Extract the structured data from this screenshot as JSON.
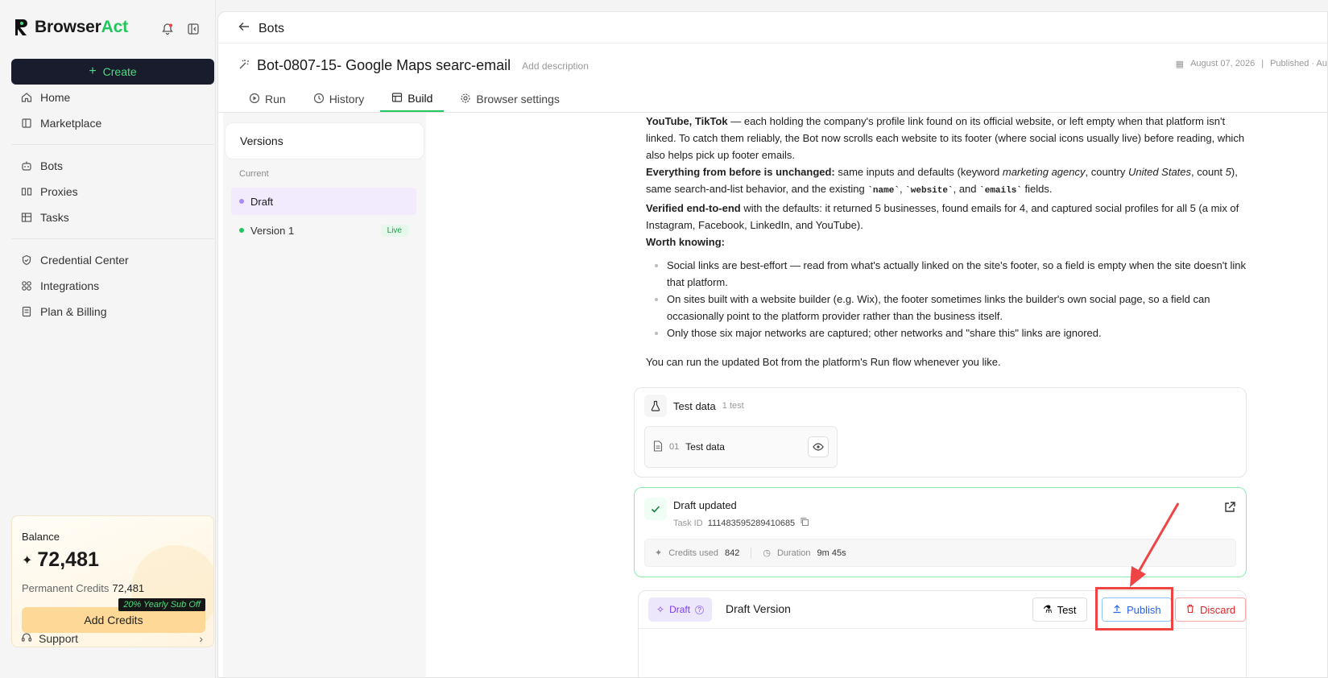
{
  "sidebar": {
    "brand_primary": "Browser",
    "brand_accent": "Act",
    "create_label": "Create",
    "items_group1": [
      {
        "label": "Home",
        "icon": "home-icon"
      },
      {
        "label": "Marketplace",
        "icon": "store-icon"
      }
    ],
    "items_group2": [
      {
        "label": "Bots",
        "icon": "bot-icon"
      },
      {
        "label": "Proxies",
        "icon": "proxy-icon"
      },
      {
        "label": "Tasks",
        "icon": "tasks-icon"
      }
    ],
    "items_group3": [
      {
        "label": "Credential Center",
        "icon": "shield-icon"
      },
      {
        "label": "Integrations",
        "icon": "integrations-icon"
      },
      {
        "label": "Plan & Billing",
        "icon": "billing-icon"
      }
    ],
    "balance": {
      "label": "Balance",
      "value": "72,481",
      "permanent_label": "Permanent Credits",
      "permanent_value": "72,481",
      "promo": "20% Yearly Sub Off",
      "add_label": "Add Credits"
    },
    "support_label": "Support"
  },
  "header": {
    "breadcrumb": "Bots",
    "bot_title": "Bot-0807-15- Google Maps searc-email",
    "add_description": "Add description",
    "date": "August 07, 2026",
    "status": "Published · Au"
  },
  "tabs": [
    {
      "label": "Run",
      "icon": "play-icon"
    },
    {
      "label": "History",
      "icon": "clock-icon"
    },
    {
      "label": "Build",
      "icon": "build-icon"
    },
    {
      "label": "Browser settings",
      "icon": "gear-icon"
    }
  ],
  "versions": {
    "header": "Versions",
    "current_label": "Current",
    "draft": "Draft",
    "version1": "Version 1",
    "live_badge": "Live"
  },
  "message": {
    "p1_bold": "YouTube, TikTok",
    "p1_rest": " — each holding the company's profile link found on its official website, or left empty when that platform isn't linked. To catch them reliably, the Bot now scrolls each website to its footer (where social icons usually live) before reading, which also helps pick up footer emails.",
    "p2_bold": "Everything from before is unchanged:",
    "p2_a": " same inputs and defaults (keyword ",
    "p2_kw": "marketing agency",
    "p2_b": ", country ",
    "p2_country": "United States",
    "p2_c": ", count ",
    "p2_count": "5",
    "p2_d": "), same search-and-list behavior, and the existing ",
    "code_name": "`name`",
    "sep1": ", ",
    "code_website": "`website`",
    "sep2": ", and ",
    "code_emails": "`emails`",
    "p2_e": " fields.",
    "p3_bold": "Verified end-to-end",
    "p3_rest": " with the defaults: it returned 5 businesses, found emails for 4, and captured social profiles for all 5 (a mix of Instagram, Facebook, LinkedIn, and YouTube).",
    "p4_bold": "Worth knowing:",
    "bullets": [
      "Social links are best-effort — read from what's actually linked on the site's footer, so a field is empty when the site doesn't link that platform.",
      "On sites built with a website builder (e.g. Wix), the footer sometimes links the builder's own social page, so a field can occasionally point to the platform provider rather than the business itself.",
      "Only those six major networks are captured; other networks and \"share this\" links are ignored."
    ],
    "closing": "You can run the updated Bot from the platform's Run flow whenever you like."
  },
  "test_card": {
    "title": "Test data",
    "count": "1 test",
    "item_index": "01",
    "item_label": "Test data"
  },
  "draft_card": {
    "title": "Draft updated",
    "task_label": "Task ID",
    "task_id": "111483595289410685",
    "credits_label": "Credits used",
    "credits_value": "842",
    "duration_label": "Duration",
    "duration_value": "9m 45s"
  },
  "draft_version": {
    "badge": "Draft",
    "title": "Draft Version",
    "test_label": "Test",
    "publish_label": "Publish",
    "discard_label": "Discard"
  },
  "colors": {
    "accent": "#22c55e",
    "create_bg": "#181c2c",
    "highlight": "#ef4444",
    "publish": "#2563eb",
    "discard": "#dc2626"
  }
}
